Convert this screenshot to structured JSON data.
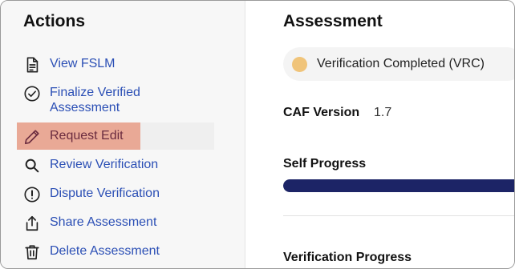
{
  "sidebar": {
    "title": "Actions",
    "items": [
      {
        "label": "View FSLM",
        "icon": "document-icon"
      },
      {
        "label": "Finalize Verified Assessment",
        "icon": "check-circle-icon"
      },
      {
        "label": "Request Edit",
        "icon": "pencil-icon"
      },
      {
        "label": "Review Verification",
        "icon": "search-icon"
      },
      {
        "label": "Dispute Verification",
        "icon": "alert-circle-icon"
      },
      {
        "label": "Share Assessment",
        "icon": "share-icon"
      },
      {
        "label": "Delete Assessment",
        "icon": "trash-icon"
      }
    ]
  },
  "main": {
    "title": "Assessment",
    "status": {
      "label": "Verification Completed (VRC)",
      "dot_color": "#f0c47a"
    },
    "caf": {
      "label": "CAF Version",
      "value": "1.7"
    },
    "self_progress": {
      "label": "Self Progress",
      "fraction": 1.0,
      "color": "#1c2466"
    },
    "verification_progress": {
      "label": "Verification Progress"
    }
  },
  "colors": {
    "link": "#2b4fb5",
    "highlight": "#e9a996"
  }
}
